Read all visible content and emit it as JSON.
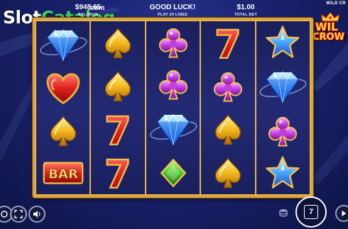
{
  "branding": {
    "watermark_slot": "Slot",
    "watermark_catalog": "Catalog",
    "watermark_com": ".com",
    "game_title_small": "WILD CR",
    "game_logo_line1": "WIL",
    "game_logo_line2": "CROW"
  },
  "reels": [
    [
      "diamond",
      "heart",
      "spade",
      "bar"
    ],
    [
      "spade",
      "spade",
      "seven",
      "seven"
    ],
    [
      "club",
      "club",
      "diamond",
      "green-diamond"
    ],
    [
      "seven",
      "club",
      "spade",
      "spade"
    ],
    [
      "star",
      "diamond",
      "club",
      "star"
    ]
  ],
  "symbol_text": {
    "bar": "BAR",
    "seven": "7"
  },
  "bottom_bar": {
    "balance_value": "$948.65",
    "balance_label": "BALANCE",
    "message": "GOOD LUCK!",
    "lines_text": "PLAY 20 LINES",
    "bet_value": "$1.00",
    "bet_label": "TOTAL BET",
    "autoplay_count": "7"
  },
  "colors": {
    "frame_gold": "#e6b44a",
    "reel_bg": "#1f2568",
    "watermark_green": "#3bd36a"
  }
}
